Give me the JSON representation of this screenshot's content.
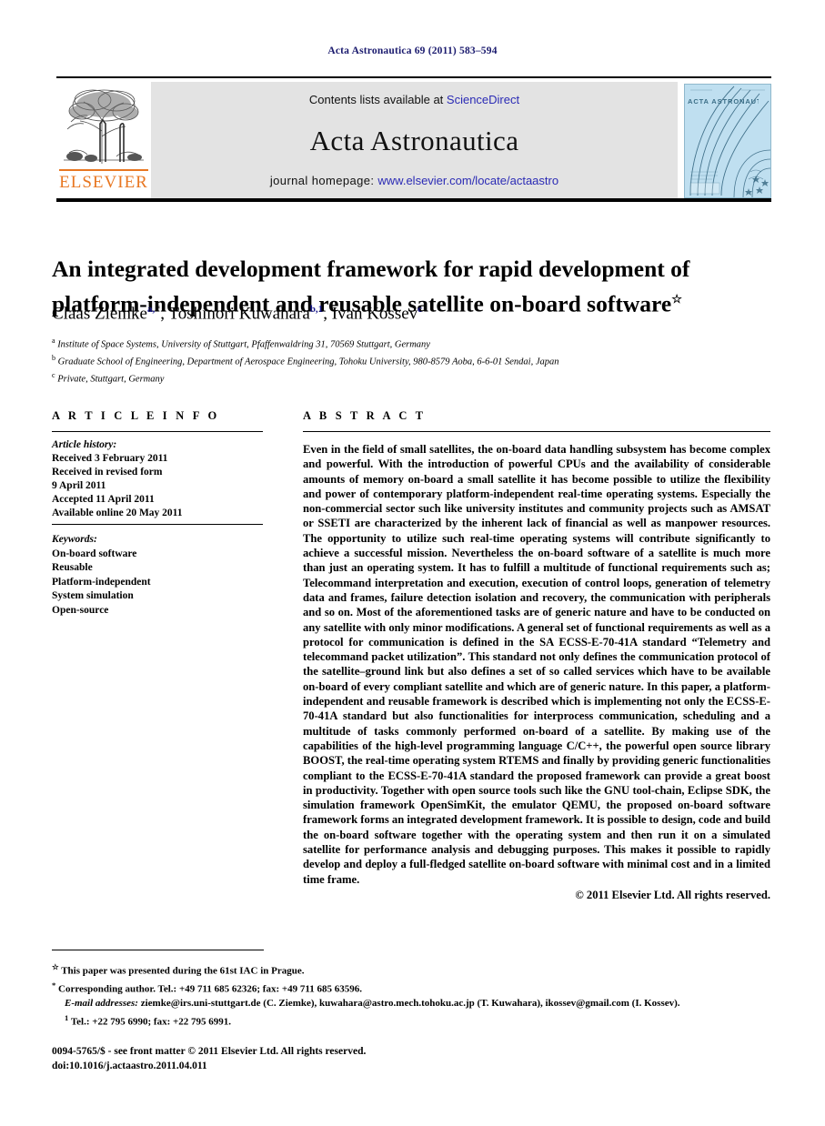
{
  "running_head": "Acta Astronautica 69 (2011) 583–594",
  "masthead": {
    "publisher_logo_name": "elsevier-tree-logo",
    "publisher_wordmark": "ELSEVIER",
    "contents_prefix": "Contents lists available at ",
    "contents_link": "ScienceDirect",
    "journal_title": "Acta Astronautica",
    "homepage_label": "journal homepage: ",
    "homepage_url": "www.elsevier.com/locate/actaastro",
    "cover_title": "ACTA ASTRONAUTICA",
    "link_color": "#2b2bb5",
    "band_color": "#e3e3e3",
    "cover_color": "#bfdff0",
    "elsevier_orange": "#E87722"
  },
  "article": {
    "title": "An integrated development framework for rapid development of platform-independent and reusable satellite on-board software",
    "title_footnote_mark": "☆",
    "authors": [
      {
        "name": "Claas Ziemke",
        "marks": "a,",
        "star": "*"
      },
      {
        "name": "Toshinori Kuwahara",
        "marks": "b,1",
        "star": ""
      },
      {
        "name": "Ivan Kossev",
        "marks": "c",
        "star": ""
      }
    ],
    "affiliations": [
      {
        "mark": "a",
        "text": "Institute of Space Systems, University of Stuttgart, Pfaffenwaldring 31, 70569 Stuttgart, Germany"
      },
      {
        "mark": "b",
        "text": "Graduate School of Engineering, Department of Aerospace Engineering, Tohoku University, 980-8579 Aoba, 6-6-01 Sendai, Japan"
      },
      {
        "mark": "c",
        "text": "Private, Stuttgart, Germany"
      }
    ]
  },
  "article_info": {
    "heading": "A R T I C L E  I N F O",
    "history_label": "Article history:",
    "history": [
      "Received 3 February 2011",
      "Received in revised form",
      "9 April 2011",
      "Accepted 11 April 2011",
      "Available online 20 May 2011"
    ],
    "keywords_label": "Keywords:",
    "keywords": [
      "On-board software",
      "Reusable",
      "Platform-independent",
      "System simulation",
      "Open-source"
    ]
  },
  "abstract": {
    "heading": "A B S T R A C T",
    "text": "Even in the field of small satellites, the on-board data handling subsystem has become complex and powerful. With the introduction of powerful CPUs and the availability of considerable amounts of memory on-board a small satellite it has become possible to utilize the flexibility and power of contemporary platform-independent real-time operating systems. Especially the non-commercial sector such like university institutes and community projects such as AMSAT or SSETI are characterized by the inherent lack of financial as well as manpower resources. The opportunity to utilize such real-time operating systems will contribute significantly to achieve a successful mission. Nevertheless the on-board software of a satellite is much more than just an operating system. It has to fulfill a multitude of functional requirements such as; Telecommand interpretation and execution, execution of control loops, generation of telemetry data and frames, failure detection isolation and recovery, the communication with peripherals and so on. Most of the aforementioned tasks are of generic nature and have to be conducted on any satellite with only minor modifications. A general set of functional requirements as well as a protocol for communication is defined in the SA ECSS-E-70-41A standard “Telemetry and telecommand packet utilization”. This standard not only defines the communication protocol of the satellite–ground link but also defines a set of so called services which have to be available on-board of every compliant satellite and which are of generic nature. In this paper, a platform-independent and reusable framework is described which is implementing not only the ECSS-E-70-41A standard but also functionalities for interprocess communication, scheduling and a multitude of tasks commonly performed on-board of a satellite. By making use of the capabilities of the high-level programming language C/C++, the powerful open source library BOOST, the real-time operating system RTEMS and finally by providing generic functionalities compliant to the ECSS-E-70-41A standard the proposed framework can provide a great boost in productivity. Together with open source tools such like the GNU tool-chain, Eclipse SDK, the simulation framework OpenSimKit, the emulator QEMU, the proposed on-board software framework forms an integrated development framework. It is possible to design, code and build the on-board software together with the operating system and then run it on a simulated satellite for performance analysis and debugging purposes. This makes it possible to rapidly develop and deploy a full-fledged satellite on-board software with minimal cost and in a limited time frame.",
    "copyright": "© 2011 Elsevier Ltd. All rights reserved."
  },
  "footnotes": {
    "star_mark": "☆",
    "star_text": "This paper was presented during the 61st IAC in Prague.",
    "corr_mark": "*",
    "corr_text": "Corresponding author. Tel.: +49 711 685 62326; fax: +49 711 685 63596.",
    "email_label": "E-mail addresses:",
    "email_text": " ziemke@irs.uni-stuttgart.de (C. Ziemke), kuwahara@astro.mech.tohoku.ac.jp (T. Kuwahara), ikossev@gmail.com (I. Kossev).",
    "note1_mark": "1",
    "note1_text": "Tel.: +22 795 6990; fax: +22 795 6991."
  },
  "imprint": {
    "line1": "0094-5765/$ - see front matter © 2011 Elsevier Ltd. All rights reserved.",
    "line2": "doi:10.1016/j.actaastro.2011.04.011"
  }
}
